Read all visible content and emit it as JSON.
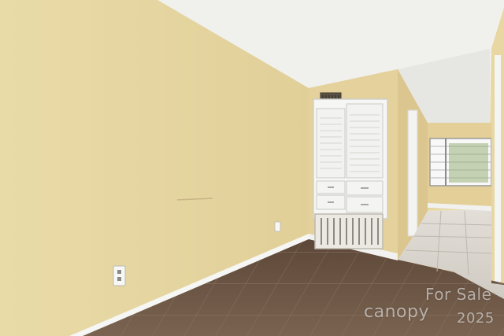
{
  "image": {
    "scene": "empty room interior with hallway",
    "watermark": {
      "line1": "For Sale",
      "brand": "canopy",
      "year": "2025"
    }
  },
  "colors": {
    "wall_main": "#e6d6a4",
    "wall_shadow": "#d8c48f",
    "ceiling": "#f2f2ef",
    "floor_tile": "#6d5645",
    "hall_floor": "#d7d3cc",
    "baseboard": "#f7f7f5",
    "cabinet": "#f6f6f4"
  }
}
